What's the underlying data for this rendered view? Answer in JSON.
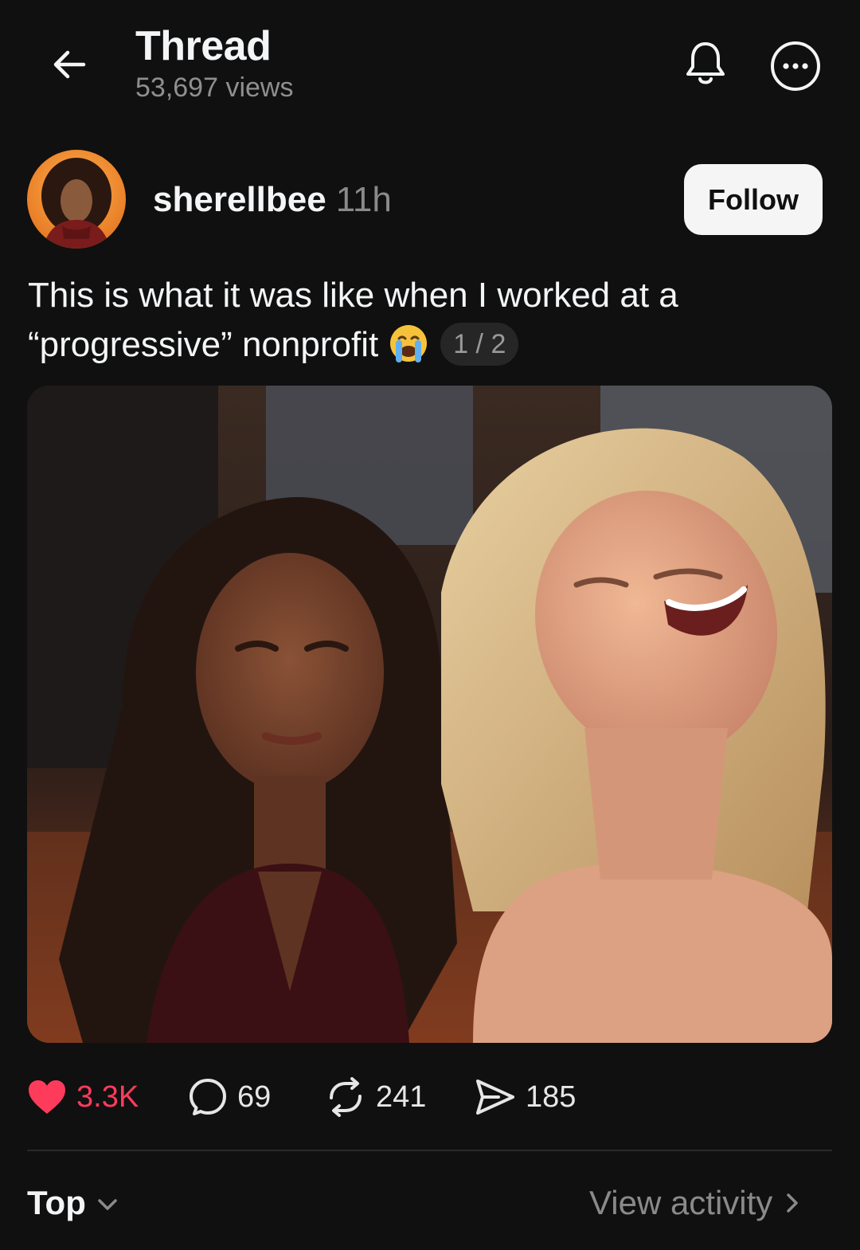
{
  "header": {
    "title": "Thread",
    "views": "53,697 views"
  },
  "post": {
    "author": "sherellbee",
    "time": "11h",
    "follow_label": "Follow",
    "text_line1": "This is what it was like when I worked at a",
    "text_line2": "“progressive” nonprofit",
    "emoji": "loudly-crying-face",
    "page_indicator": "1 / 2"
  },
  "actions": {
    "likes": "3.3K",
    "replies": "69",
    "reposts": "241",
    "shares": "185"
  },
  "footer": {
    "sort_label": "Top",
    "view_activity": "View activity"
  },
  "colors": {
    "background": "#101010",
    "like": "#ff3b5c",
    "muted": "#8a8a8a",
    "follow_bg": "#f5f5f5"
  }
}
